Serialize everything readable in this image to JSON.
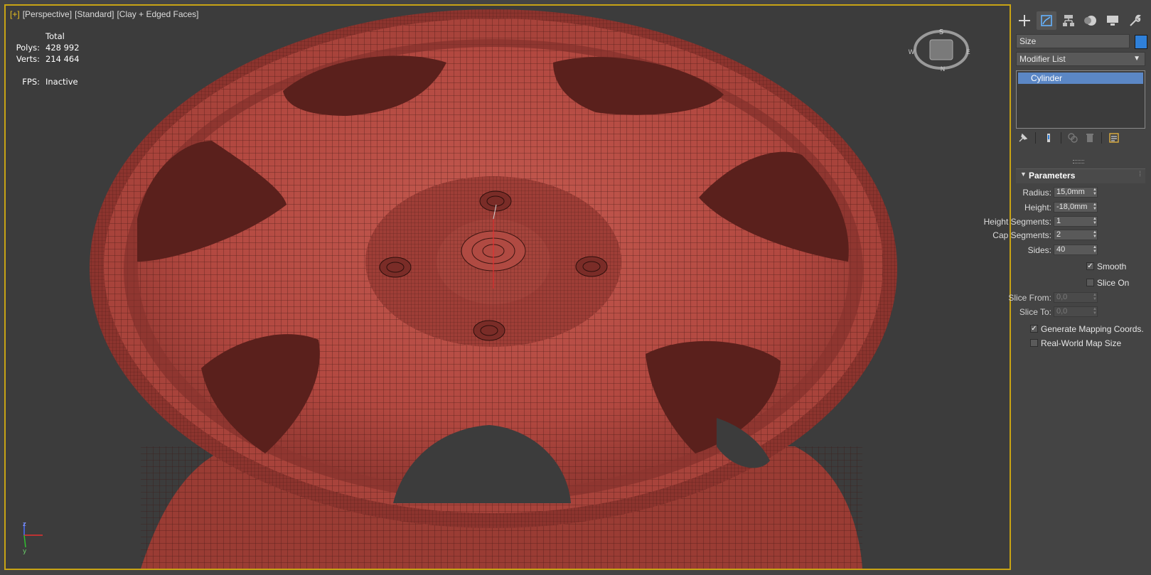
{
  "viewport": {
    "labels": [
      "[+]",
      "[Perspective]",
      "[Standard]",
      "[Clay + Edged Faces]"
    ],
    "stats": {
      "header": "Total",
      "polys_label": "Polys:",
      "polys": "428 992",
      "verts_label": "Verts:",
      "verts": "214 464",
      "fps_label": "FPS:",
      "fps": "Inactive"
    },
    "viewcube": {
      "top": "S",
      "left": "W",
      "right": "E",
      "bottom": "N"
    },
    "axis": {
      "z": "z",
      "y": "y"
    },
    "colors": {
      "border": "#c8a414",
      "mesh": "#b54a40",
      "wire": "#3a1410",
      "background": "#3c3c3c"
    }
  },
  "panel": {
    "tabs": [
      "create-icon",
      "modify-icon",
      "hierarchy-icon",
      "motion-icon",
      "display-icon",
      "utilities-icon"
    ],
    "object_name": "Size",
    "object_color": "#2f80d9",
    "modifier_list": "Modifier List",
    "stack": [
      "Cylinder"
    ],
    "rollout_title": "Parameters",
    "params": [
      {
        "label": "Radius:",
        "value": "15,0mm"
      },
      {
        "label": "Height:",
        "value": "-18,0mm"
      },
      {
        "label": "Height Segments:",
        "value": "1"
      },
      {
        "label": "Cap Segments:",
        "value": "2"
      },
      {
        "label": "Sides:",
        "value": "40"
      }
    ],
    "smooth": {
      "label": "Smooth",
      "checked": true
    },
    "slice_on": {
      "label": "Slice On",
      "checked": false
    },
    "slice_from": {
      "label": "Slice From:",
      "value": "0,0"
    },
    "slice_to": {
      "label": "Slice To:",
      "value": "0,0"
    },
    "gen_mapping": {
      "label": "Generate Mapping Coords.",
      "checked": true
    },
    "real_world": {
      "label": "Real-World Map Size",
      "checked": false
    }
  }
}
